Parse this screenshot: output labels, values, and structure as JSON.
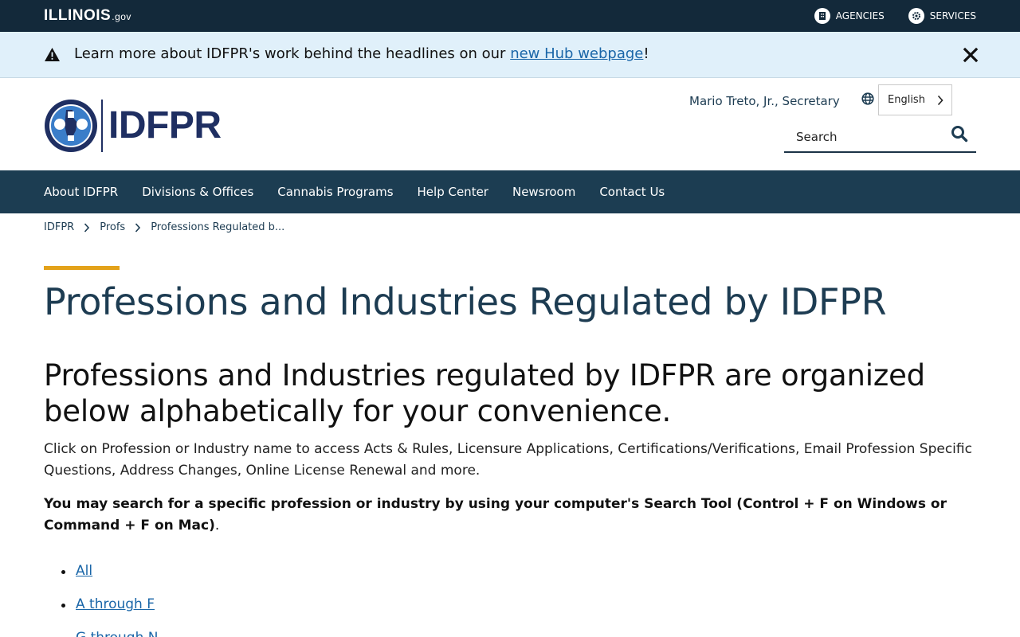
{
  "statebar": {
    "logo_text": "ILLINOIS",
    "logo_suffix": ".gov",
    "agencies_label": "AGENCIES",
    "services_label": "SERVICES"
  },
  "alert": {
    "text_before": "Learn more about IDFPR's work behind the headlines on our ",
    "link_text": "new Hub webpage",
    "text_after": "!"
  },
  "header": {
    "logo_text": "IDFPR",
    "secretary": "Mario Treto, Jr., Secretary",
    "language": "English",
    "search_placeholder": "Search"
  },
  "mainnav": {
    "items": [
      "About IDFPR",
      "Divisions & Offices",
      "Cannabis Programs",
      "Help Center",
      "Newsroom",
      "Contact Us"
    ]
  },
  "breadcrumb": {
    "items": [
      "IDFPR",
      "Profs",
      "Professions Regulated b..."
    ]
  },
  "content": {
    "title": "Professions and Industries Regulated by IDFPR",
    "heading": "Professions and Industries regulated by IDFPR are organized below alphabetically for your convenience.",
    "intro": "Click on Profession or Industry name to access Acts & Rules, Licensure Applications, Certifications/Verifications, Email Profession Specific Questions, Address Changes, Online License Renewal and more.",
    "tip_bold": "You may search for a specific profession or industry by using your computer's Search Tool (Control + F on Windows or Command + F on Mac)",
    "tip_end": ".",
    "links": [
      "All",
      "A through F",
      "G through N"
    ]
  },
  "colors": {
    "statebar_bg": "#13293a",
    "alert_bg": "#e0f0fa",
    "nav_bg": "#1c3d52",
    "accent": "#e3a21a",
    "link": "#1a66a8",
    "logo": "#1f2f62"
  },
  "icons": {
    "agencies": "building-icon",
    "services": "gear-icon",
    "alert": "warning-icon",
    "close": "close-icon",
    "language": "globe-icon",
    "search": "search-icon",
    "breadcrumb_separator": "chevron-right-icon"
  }
}
